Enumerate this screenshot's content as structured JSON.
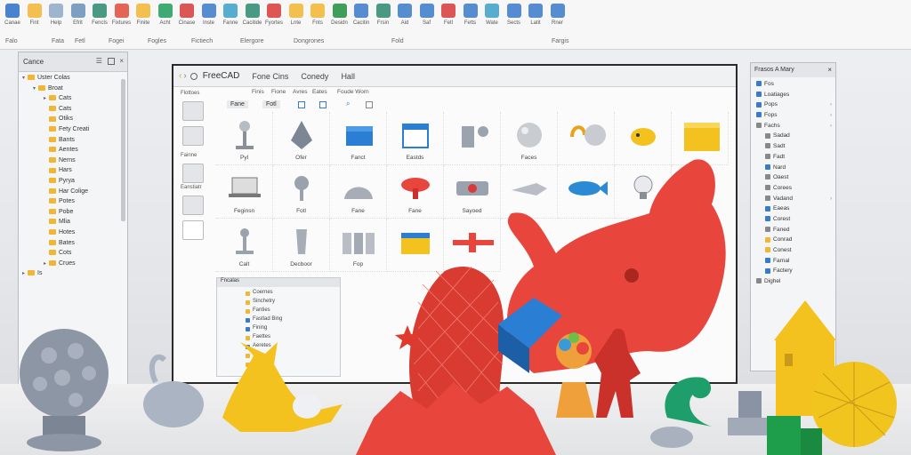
{
  "ribbon": {
    "buttons": [
      {
        "label": "Canae",
        "icon": "blue-ring-icon",
        "color": "#2a6fc9"
      },
      {
        "label": "Fint",
        "icon": "folder-icon",
        "color": "#f2b632"
      },
      {
        "label": "Help",
        "icon": "page-icon",
        "color": "#8fa8c8"
      },
      {
        "label": "Efrit",
        "icon": "cursor-icon",
        "color": "#6a8fb8"
      },
      {
        "label": "Fencls",
        "icon": "gear-icon",
        "color": "#2b8a6e"
      },
      {
        "label": "Fixtures",
        "icon": "refresh-icon",
        "color": "#e04a3a"
      },
      {
        "label": "Finite",
        "icon": "folder-icon",
        "color": "#f2b632"
      },
      {
        "label": "Acht",
        "icon": "circle-icon",
        "color": "#1e9e5a"
      },
      {
        "label": "Cinase",
        "icon": "cube-icon",
        "color": "#d83a3a"
      },
      {
        "label": "Inste",
        "icon": "wrench-icon",
        "color": "#3a7ac9"
      },
      {
        "label": "Fanne",
        "icon": "pen-icon",
        "color": "#3aa0c9"
      },
      {
        "label": "Cacitide",
        "icon": "pencil-icon",
        "color": "#2b8a6e"
      },
      {
        "label": "Fyortes",
        "icon": "image-icon",
        "color": "#d83a3a"
      },
      {
        "label": "Lnte",
        "icon": "page-icon",
        "color": "#f2b632"
      },
      {
        "label": "Fnts",
        "icon": "page-icon",
        "color": "#f2b632"
      },
      {
        "label": "Desidn",
        "icon": "excel-icon",
        "color": "#1e8e3e"
      },
      {
        "label": "Cacitin",
        "icon": "grid-icon",
        "color": "#3a7ac9"
      },
      {
        "label": "Frsin",
        "icon": "tools-icon",
        "color": "#2b8a6e"
      },
      {
        "label": "Aid",
        "icon": "search-icon",
        "color": "#3a7ac9"
      },
      {
        "label": "Saf",
        "icon": "pen-icon",
        "color": "#3a7ac9"
      },
      {
        "label": "Fetl",
        "icon": "node-icon",
        "color": "#d83a3a"
      },
      {
        "label": "Fetts",
        "icon": "table-icon",
        "color": "#3a7ac9"
      },
      {
        "label": "Wate",
        "icon": "arrow-icon",
        "color": "#3aa0c9"
      },
      {
        "label": "Sects",
        "icon": "keyboard-icon",
        "color": "#3a7ac9"
      },
      {
        "label": "Latit",
        "icon": "wrench-icon",
        "color": "#3a7ac9"
      },
      {
        "label": "Rner",
        "icon": "edit-icon",
        "color": "#3a7ac9"
      }
    ],
    "groups": [
      "Falo",
      "Fata",
      "Fetl",
      "Fogei",
      "Fogles",
      "Fictiech",
      "Elergore",
      "Dongrones",
      "Fold",
      "Fargis"
    ]
  },
  "tree": {
    "header": "Cance",
    "header_icons": [
      "list-icon",
      "view-icon",
      "close-icon"
    ],
    "items": [
      {
        "label": "Uster Colas",
        "depth": 0,
        "twisty": "▾"
      },
      {
        "label": "Broat",
        "depth": 1,
        "twisty": "▾"
      },
      {
        "label": "Cats",
        "depth": 2,
        "twisty": "▸"
      },
      {
        "label": "Cats",
        "depth": 2,
        "twisty": ""
      },
      {
        "label": "Otiks",
        "depth": 2,
        "twisty": ""
      },
      {
        "label": "Fety Creati",
        "depth": 2,
        "twisty": ""
      },
      {
        "label": "Bants",
        "depth": 2,
        "twisty": ""
      },
      {
        "label": "Aentes",
        "depth": 2,
        "twisty": ""
      },
      {
        "label": "Nerns",
        "depth": 2,
        "twisty": ""
      },
      {
        "label": "Hars",
        "depth": 2,
        "twisty": ""
      },
      {
        "label": "Pyrya",
        "depth": 2,
        "twisty": ""
      },
      {
        "label": "Har Colige",
        "depth": 2,
        "twisty": ""
      },
      {
        "label": "Potes",
        "depth": 2,
        "twisty": ""
      },
      {
        "label": "Pobe",
        "depth": 2,
        "twisty": ""
      },
      {
        "label": "Mlia",
        "depth": 2,
        "twisty": ""
      },
      {
        "label": "Hotes",
        "depth": 2,
        "twisty": ""
      },
      {
        "label": "Bates",
        "depth": 2,
        "twisty": ""
      },
      {
        "label": "Cots",
        "depth": 2,
        "twisty": ""
      },
      {
        "label": "Crues",
        "depth": 2,
        "twisty": "▸"
      },
      {
        "label": "Is",
        "depth": 0,
        "twisty": "▸"
      }
    ]
  },
  "window": {
    "title": "FreeCAD",
    "menus": [
      "Fone Cins",
      "Conedy",
      "Hall"
    ],
    "toolbar": [
      "Finis",
      "Fione",
      "Avres",
      "Eates",
      "Foude Worn"
    ],
    "tabs": [
      "Fane",
      "Fotl"
    ],
    "side_labels": [
      "Flottoes",
      "Fainne",
      "Eanstiatr"
    ],
    "grid_rows": [
      [
        {
          "label": "Pyl",
          "shape": "stand"
        },
        {
          "label": "Ofer",
          "shape": "diamond"
        },
        {
          "label": "Fanct",
          "shape": "box"
        },
        {
          "label": "Eastds",
          "shape": "calendar"
        },
        {
          "label": "",
          "shape": "faucet"
        },
        {
          "label": "Faces",
          "shape": "sphere"
        },
        {
          "label": "",
          "shape": "coil"
        },
        {
          "label": "",
          "shape": "critter"
        },
        {
          "label": "",
          "shape": "block"
        }
      ],
      [
        {
          "label": "Feginsn",
          "shape": "laptop"
        },
        {
          "label": "Fotl",
          "shape": "pin"
        },
        {
          "label": "Fane",
          "shape": "dome"
        },
        {
          "label": "Fane",
          "shape": "mushroom"
        },
        {
          "label": "Sayoed",
          "shape": "engine"
        },
        {
          "label": "",
          "shape": "arrow"
        },
        {
          "label": "",
          "shape": "fish"
        },
        {
          "label": "",
          "shape": "bulb"
        }
      ],
      [
        {
          "label": "Calt",
          "shape": "lamp"
        },
        {
          "label": "Decboor",
          "shape": "vase"
        },
        {
          "label": "Fop",
          "shape": "panels"
        },
        {
          "label": "",
          "shape": "house"
        },
        {
          "label": "",
          "shape": "plane"
        }
      ]
    ],
    "props_title": "Fncalas",
    "props": [
      {
        "label": "Coernes",
        "color": "#f2b632"
      },
      {
        "label": "Sinchetry",
        "color": "#f2b632"
      },
      {
        "label": "Fanties",
        "color": "#f2b632"
      },
      {
        "label": "Fastlad Bing",
        "color": "#3a7ac9"
      },
      {
        "label": "Fining",
        "color": "#3a7ac9"
      },
      {
        "label": "Faettes",
        "color": "#f2b632"
      },
      {
        "label": "Aeretes",
        "color": "#3a7ac9"
      },
      {
        "label": "Fes",
        "color": "#f2b632"
      },
      {
        "label": "Fes",
        "color": "#f2b632"
      }
    ]
  },
  "right_panel": {
    "header": "Frasos A Mary",
    "items": [
      {
        "label": "Fos",
        "icon_color": "#3a7ac9",
        "arrow": ""
      },
      {
        "label": "Loatiages",
        "icon_color": "#3a7ac9",
        "arrow": ""
      },
      {
        "label": "Pops",
        "icon_color": "#3a7ac9",
        "arrow": "›"
      },
      {
        "label": "Fops",
        "icon_color": "#3a7ac9",
        "arrow": "›"
      },
      {
        "label": "Fachs",
        "icon_color": "#888888",
        "arrow": "›"
      },
      {
        "label": "Sadad",
        "icon_color": "#888888",
        "arrow": ""
      },
      {
        "label": "Sadt",
        "icon_color": "#888888",
        "arrow": ""
      },
      {
        "label": "Fadt",
        "icon_color": "#888888",
        "arrow": ""
      },
      {
        "label": "Nard",
        "icon_color": "#3a7ac9",
        "arrow": ""
      },
      {
        "label": "Oaest",
        "icon_color": "#888888",
        "arrow": ""
      },
      {
        "label": "Corees",
        "icon_color": "#888888",
        "arrow": ""
      },
      {
        "label": "Vadand",
        "icon_color": "#888888",
        "arrow": "›"
      },
      {
        "label": "Eaeas",
        "icon_color": "#3a7ac9",
        "arrow": ""
      },
      {
        "label": "Corest",
        "icon_color": "#3a7ac9",
        "arrow": ""
      },
      {
        "label": "Faned",
        "icon_color": "#888888",
        "arrow": ""
      },
      {
        "label": "Conrad",
        "icon_color": "#f2b632",
        "arrow": ""
      },
      {
        "label": "Conest",
        "icon_color": "#f2b632",
        "arrow": ""
      },
      {
        "label": "Farnal",
        "icon_color": "#3a7ac9",
        "arrow": ""
      },
      {
        "label": "Factery",
        "icon_color": "#3a7ac9",
        "arrow": ""
      },
      {
        "label": "Dighel",
        "icon_color": "#888888",
        "arrow": ""
      }
    ]
  },
  "colors": {
    "accent_red": "#e8453c",
    "accent_yellow": "#f4c21f",
    "accent_blue": "#2a7fd4",
    "accent_green": "#1e9e6a",
    "window_border": "#2a2a2a"
  }
}
